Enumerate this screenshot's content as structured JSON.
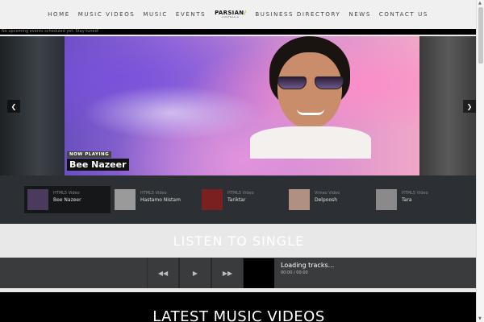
{
  "nav": {
    "items_left": [
      "HOME",
      "MUSIC VIDEOS",
      "MUSIC",
      "EVENTS"
    ],
    "logo_main": "PARSIAN",
    "logo_sub": "AUSTRALIA",
    "items_right": [
      "BUSINESS DIRECTORY",
      "NEWS",
      "CONTACT US"
    ]
  },
  "ticker": {
    "text": "No upcoming events scheduled yet. Stay tuned!"
  },
  "hero": {
    "now_playing_label": "NOW PLAYING",
    "now_playing_title": "Bee Nazeer",
    "prev_icon": "chevron-left-icon",
    "next_icon": "chevron-right-icon"
  },
  "playlist": {
    "items": [
      {
        "type": "HTML5 Video",
        "name": "Bee Nazeer",
        "active": true,
        "thumb_color": "#4a3b5c"
      },
      {
        "type": "HTML5 Video",
        "name": "Hastamo Nistam",
        "active": false,
        "thumb_color": "#9a9a9a"
      },
      {
        "type": "HTML5 Video",
        "name": "Tariktar",
        "active": false,
        "thumb_color": "#7a2020"
      },
      {
        "type": "Vimeo Video",
        "name": "Delpoosh",
        "active": false,
        "thumb_color": "#b09080"
      },
      {
        "type": "HTML5 Video",
        "name": "Tara",
        "active": false,
        "thumb_color": "#8a8a8a"
      }
    ]
  },
  "listen": {
    "heading": "LISTEN TO SINGLE"
  },
  "player": {
    "track_title": "Loading tracks...",
    "time": "00:00 / 00:00",
    "prev_icon": "skip-back-icon",
    "play_icon": "play-icon",
    "next_icon": "skip-forward-icon"
  },
  "videos": {
    "heading": "LATEST MUSIC VIDEOS"
  }
}
